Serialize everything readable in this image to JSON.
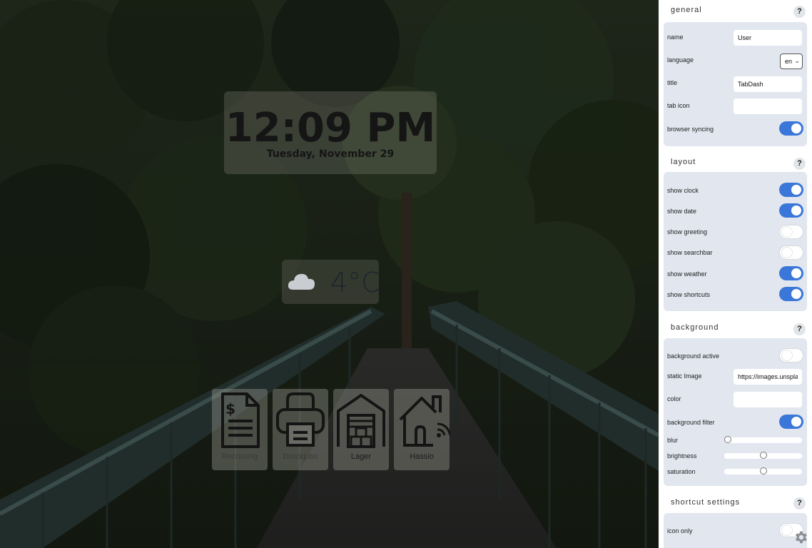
{
  "clock": {
    "time": "12:09 PM",
    "date": "Tuesday, November 29"
  },
  "weather": {
    "icon": "cloud-icon",
    "temperature": "4°C"
  },
  "shortcuts": [
    {
      "label": "Rechnung",
      "icon": "invoice-icon"
    },
    {
      "label": "Druckjobs",
      "icon": "printer-icon"
    },
    {
      "label": "Lager",
      "icon": "warehouse-icon"
    },
    {
      "label": "Hassio",
      "icon": "smart-home-icon"
    }
  ],
  "settings": {
    "general": {
      "title": "general",
      "help": "?",
      "name_label": "name",
      "name_value": "User",
      "language_label": "language",
      "language_value": "en",
      "title_label": "title",
      "title_value": "TabDash",
      "tab_icon_label": "tab icon",
      "tab_icon_value": "",
      "browser_syncing_label": "browser syncing",
      "browser_syncing": true
    },
    "layout": {
      "title": "layout",
      "help": "?",
      "toggles": [
        {
          "label": "show clock",
          "on": true
        },
        {
          "label": "show date",
          "on": true
        },
        {
          "label": "show greeting",
          "on": false
        },
        {
          "label": "show searchbar",
          "on": false
        },
        {
          "label": "show weather",
          "on": true
        },
        {
          "label": "show shortcuts",
          "on": true
        }
      ]
    },
    "background": {
      "title": "background",
      "help": "?",
      "active_label": "background active",
      "active": false,
      "static_image_label": "static Image",
      "static_image_value": "https://images.unsplash",
      "color_label": "color",
      "color_value": "",
      "filter_label": "background filter",
      "filter": true,
      "blur_label": "blur",
      "blur": 0,
      "brightness_label": "brightness",
      "brightness": 0.5,
      "saturation_label": "saturation",
      "saturation": 0.5
    },
    "shortcut_settings": {
      "title": "shortcut settings",
      "help": "?",
      "icon_only_label": "icon only",
      "icon_only": false
    }
  },
  "colors": {
    "accent": "#3a77d9",
    "panel_group": "#e1e6ef"
  }
}
